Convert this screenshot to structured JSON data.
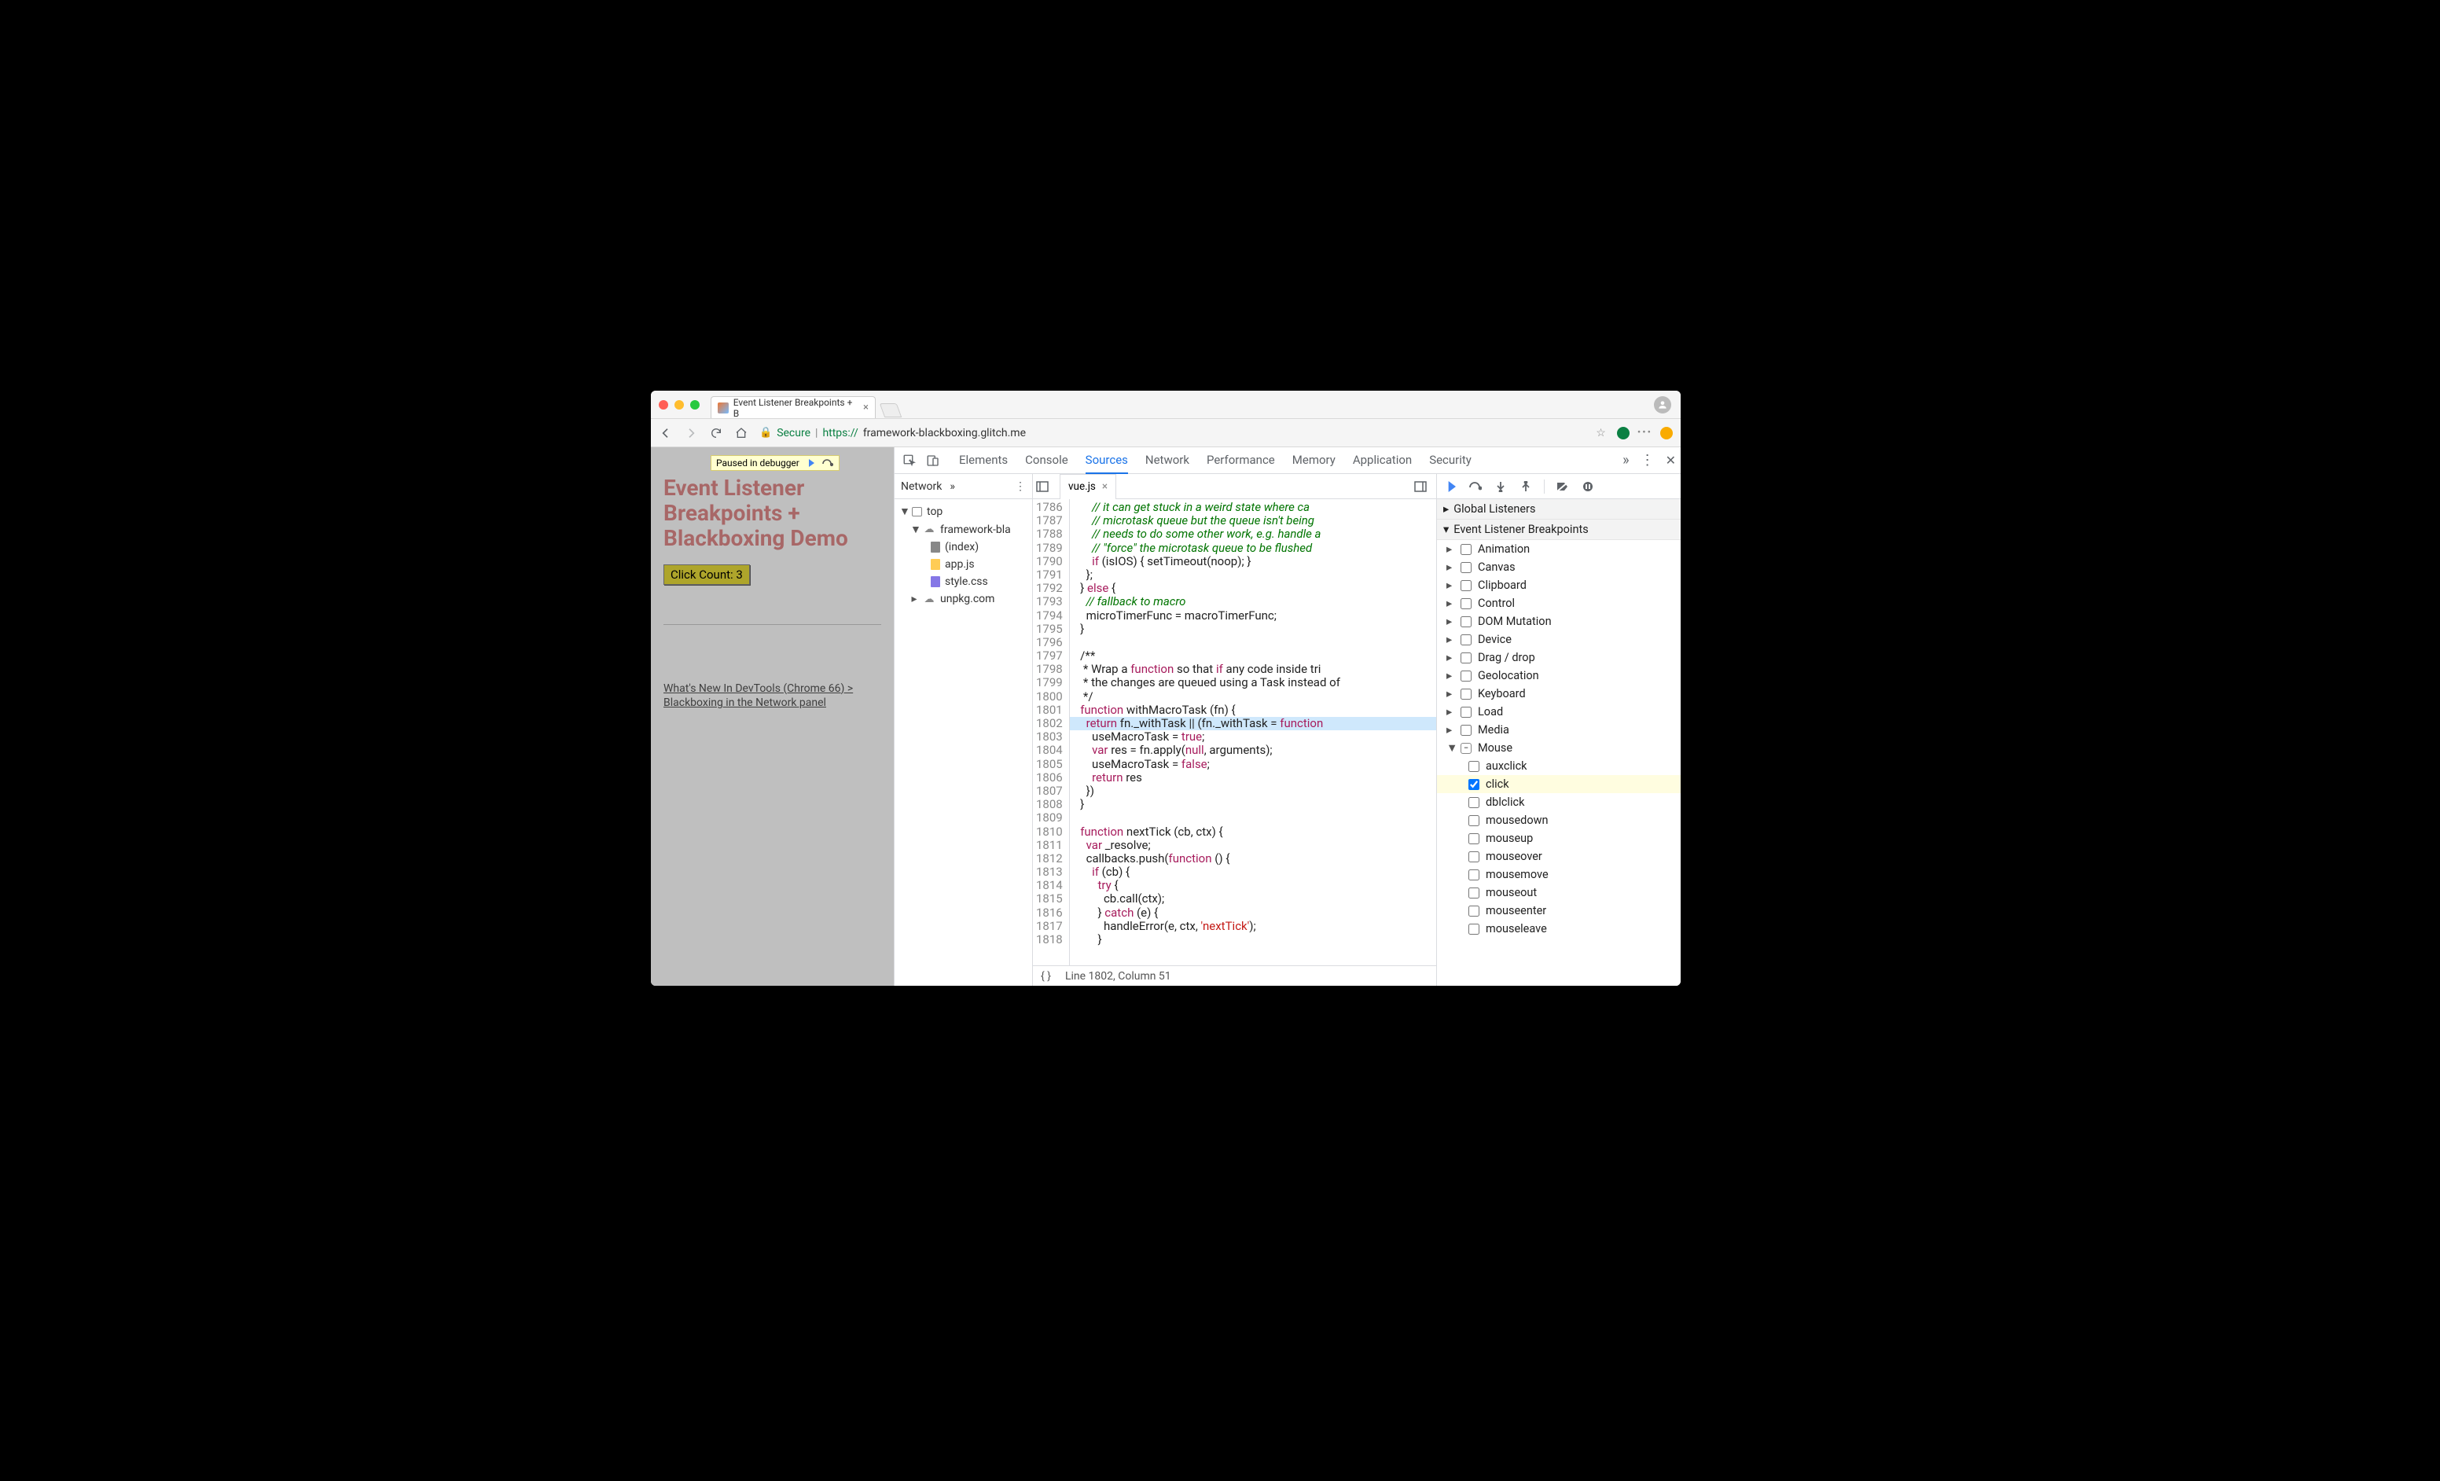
{
  "browser": {
    "tab_title": "Event Listener Breakpoints + B",
    "secure_label": "Secure",
    "url_prefix": "https://",
    "url_host": "framework-blackboxing.glitch.me"
  },
  "page": {
    "paused_label": "Paused in debugger",
    "heading": "Event Listener Breakpoints + Blackboxing Demo",
    "click_count": "Click Count: 3",
    "link": "What's New In DevTools (Chrome 66) > Blackboxing in the Network panel"
  },
  "devtools": {
    "panels": [
      "Elements",
      "Console",
      "Sources",
      "Network",
      "Performance",
      "Memory",
      "Application",
      "Security"
    ],
    "active_panel": "Sources",
    "nav_tab": "Network",
    "tree": {
      "top": "top",
      "domain1": "framework-bla",
      "files": [
        "(index)",
        "app.js",
        "style.css"
      ],
      "domain2": "unpkg.com"
    },
    "editor": {
      "filename": "vue.js",
      "first_line": 1786,
      "status": "Line 1802, Column 51",
      "lines": [
        "      // it can get stuck in a weird state where ca",
        "      // microtask queue but the queue isn't being",
        "      // needs to do some other work, e.g. handle a",
        "      // \"force\" the microtask queue to be flushed",
        "      if (isIOS) { setTimeout(noop); }",
        "    };",
        "  } else {",
        "    // fallback to macro",
        "    microTimerFunc = macroTimerFunc;",
        "  }",
        "",
        "  /**",
        "   * Wrap a function so that if any code inside tri",
        "   * the changes are queued using a Task instead of",
        "   */",
        "  function withMacroTask (fn) {",
        "    return fn._withTask || (fn._withTask = function",
        "      useMacroTask = true;",
        "      var res = fn.apply(null, arguments);",
        "      useMacroTask = false;",
        "      return res",
        "    })",
        "  }",
        "",
        "  function nextTick (cb, ctx) {",
        "    var _resolve;",
        "    callbacks.push(function () {",
        "      if (cb) {",
        "        try {",
        "          cb.call(ctx);",
        "        } catch (e) {",
        "          handleError(e, ctx, 'nextTick');",
        "        }"
      ],
      "highlight_index": 16
    },
    "sidebar": {
      "sections": {
        "global": "Global Listeners",
        "elb": "Event Listener Breakpoints"
      },
      "categories": [
        "Animation",
        "Canvas",
        "Clipboard",
        "Control",
        "DOM Mutation",
        "Device",
        "Drag / drop",
        "Geolocation",
        "Keyboard",
        "Load",
        "Media",
        "Mouse"
      ],
      "mouse_events": [
        "auxclick",
        "click",
        "dblclick",
        "mousedown",
        "mouseup",
        "mouseover",
        "mousemove",
        "mouseout",
        "mouseenter",
        "mouseleave"
      ],
      "checked_event": "click"
    }
  }
}
